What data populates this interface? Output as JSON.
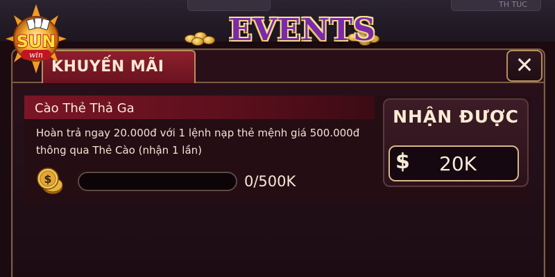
{
  "header": {
    "title": "EVENTS",
    "logo_text": "SUN",
    "logo_subtext": "win",
    "background_text": "TH TUC"
  },
  "tabs": [
    {
      "label": "KHUYẾN MÃI",
      "active": true
    }
  ],
  "close": {
    "label": "✕",
    "icon": "close-icon"
  },
  "event": {
    "title": "Cào Thẻ Thả Ga",
    "description_line1": "Hoàn trả ngay 20.000đ với 1 lệnh nạp thẻ mệnh giá 500.000đ",
    "description_line2": "thông qua Thẻ Cào (nhận 1 lần)",
    "progress_text": "0/500K",
    "progress_fraction": 0.0,
    "reward": {
      "title": "NHẬN ĐƯỢC",
      "currency_symbol": "$",
      "amount": "20K"
    }
  },
  "colors": {
    "accent_red": "#7c1526",
    "gold_border": "#b88f5c",
    "title_purple": "#7a2aa8",
    "text_light": "#f8ead8"
  }
}
